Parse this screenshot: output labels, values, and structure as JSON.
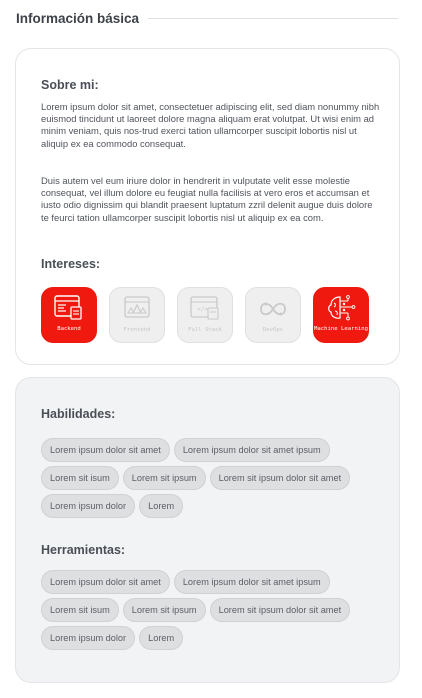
{
  "section": {
    "title": "Información básica"
  },
  "about": {
    "heading": "Sobre mi:",
    "paragraphs": [
      "Lorem ipsum dolor sit amet, consectetuer adipiscing elit, sed diam nonummy nibh euismod tincidunt ut laoreet dolore magna aliquam erat volutpat. Ut wisi enim ad minim veniam, quis nos-trud exerci tation ullamcorper suscipit lobortis nisl ut aliquip ex ea commodo consequat.",
      "Duis autem vel eum iriure dolor in hendrerit in vulputate velit esse molestie consequat, vel illum dolore eu feugiat nulla facilisis at vero eros et accumsan et iusto odio dignissim qui blandit praesent luptatum zzril delenit augue duis dolore te feurci tation ullamcorper suscipit lobortis nisl ut aliquip ex ea com."
    ]
  },
  "interests": {
    "heading": "Intereses:",
    "items": [
      {
        "label": "Backend",
        "active": true,
        "icon": "backend-icon"
      },
      {
        "label": "Frontend",
        "active": false,
        "icon": "frontend-icon"
      },
      {
        "label": "Full Stack",
        "active": false,
        "icon": "full-stack-icon"
      },
      {
        "label": "DevOps",
        "active": false,
        "icon": "devops-icon"
      },
      {
        "label": "Machine Learning",
        "active": true,
        "icon": "machine-learning-icon"
      }
    ]
  },
  "skills": {
    "heading": "Habilidades:",
    "tags": [
      "Lorem ipsum dolor sit amet",
      "Lorem ipsum dolor sit amet ipsum",
      "Lorem sit isum",
      "Lorem sit ipsum",
      "Lorem sit ipsum dolor sit amet",
      "Lorem ipsum dolor",
      "Lorem"
    ]
  },
  "tools": {
    "heading": "Herramientas:",
    "tags": [
      "Lorem ipsum dolor sit amet",
      "Lorem ipsum dolor sit amet ipsum",
      "Lorem sit isum",
      "Lorem sit ipsum",
      "Lorem sit ipsum dolor sit amet",
      "Lorem ipsum dolor",
      "Lorem"
    ]
  },
  "colors": {
    "accent": "#f0190f",
    "inactive": "#efefef",
    "chip": "#dedfe1"
  }
}
